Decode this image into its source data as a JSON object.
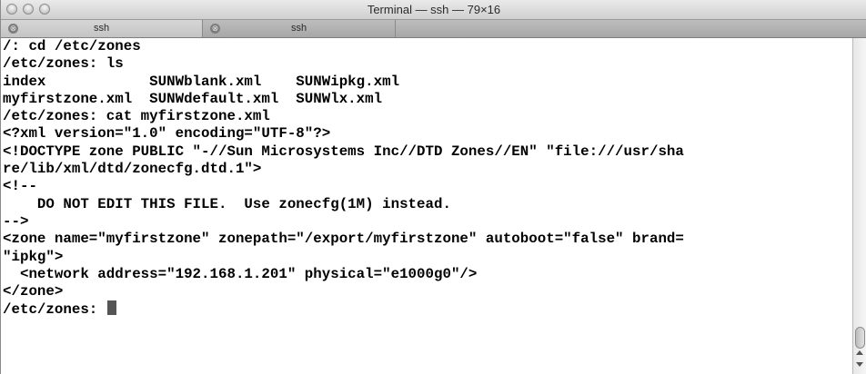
{
  "window": {
    "title": "Terminal — ssh — 79×16"
  },
  "tabs": [
    {
      "label": "ssh",
      "close_glyph": "⊗",
      "active": true
    },
    {
      "label": "ssh",
      "close_glyph": "⊗",
      "active": false
    }
  ],
  "terminal": {
    "lines": [
      "/: cd /etc/zones",
      "/etc/zones: ls",
      "index            SUNWblank.xml    SUNWipkg.xml",
      "myfirstzone.xml  SUNWdefault.xml  SUNWlx.xml",
      "/etc/zones: cat myfirstzone.xml",
      "<?xml version=\"1.0\" encoding=\"UTF-8\"?>",
      "<!DOCTYPE zone PUBLIC \"-//Sun Microsystems Inc//DTD Zones//EN\" \"file:///usr/sha",
      "re/lib/xml/dtd/zonecfg.dtd.1\">",
      "<!--",
      "    DO NOT EDIT THIS FILE.  Use zonecfg(1M) instead.",
      "-->",
      "<zone name=\"myfirstzone\" zonepath=\"/export/myfirstzone\" autoboot=\"false\" brand=",
      "\"ipkg\">",
      "  <network address=\"192.168.1.201\" physical=\"e1000g0\"/>",
      "</zone>"
    ],
    "prompt": "/etc/zones: "
  },
  "colors": {
    "text": "#000000",
    "background": "#ffffff",
    "cursor": "#555555"
  }
}
